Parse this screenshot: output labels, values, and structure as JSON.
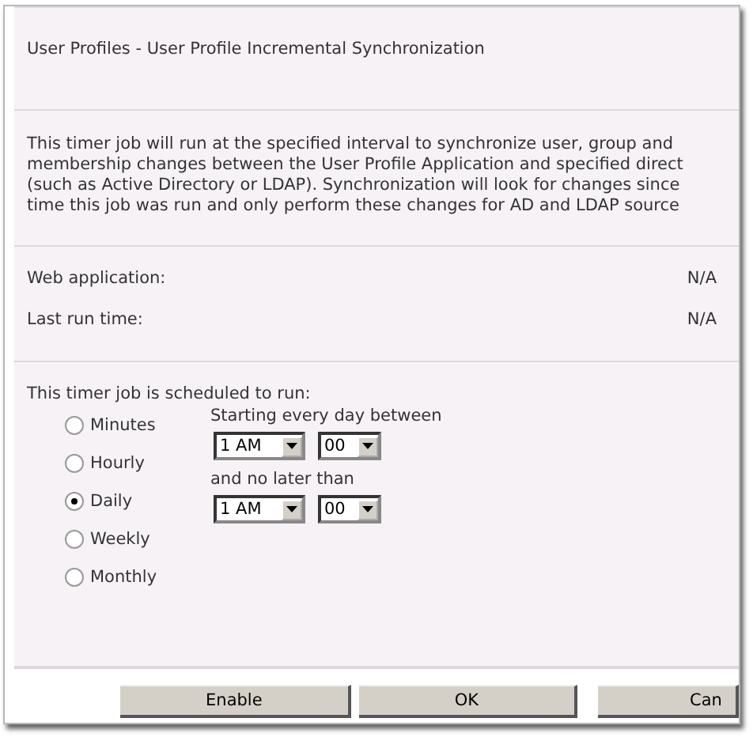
{
  "title": "User Profiles - User Profile Incremental Synchronization",
  "description_lines": [
    "This timer job will run at the specified interval to synchronize user, group and",
    "membership changes between the User Profile Application and specified direct",
    "(such as Active Directory or LDAP). Synchronization will look for changes since",
    "time this job was run and only perform these changes for AD and LDAP source"
  ],
  "properties": [
    {
      "label": "Web application:",
      "value": "N/A"
    },
    {
      "label": "Last run time:",
      "value": "N/A"
    }
  ],
  "schedule": {
    "heading": "This timer job is scheduled to run:",
    "options": [
      {
        "label": "Minutes",
        "selected": false
      },
      {
        "label": "Hourly",
        "selected": false
      },
      {
        "label": "Daily",
        "selected": true
      },
      {
        "label": "Weekly",
        "selected": false
      },
      {
        "label": "Monthly",
        "selected": false
      }
    ],
    "start_label": "Starting every day between",
    "start_hour": "1 AM",
    "start_minute": "00",
    "end_label": "and no later than",
    "end_hour": "1 AM",
    "end_minute": "00"
  },
  "buttons": [
    "Enable",
    "OK",
    "Can"
  ]
}
